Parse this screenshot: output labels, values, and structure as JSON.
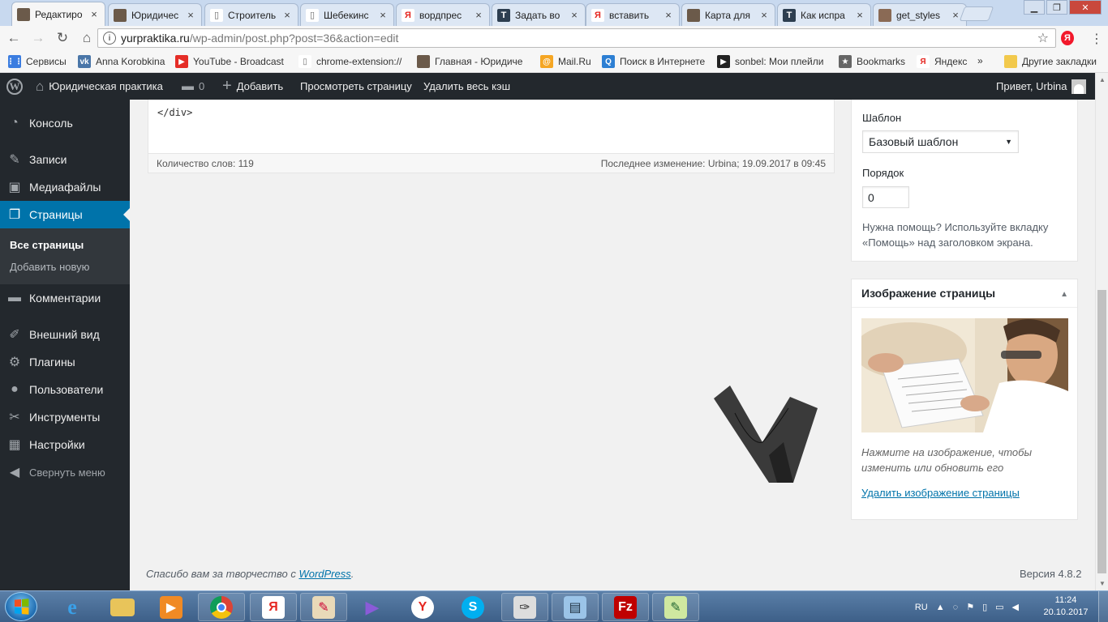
{
  "browser": {
    "tabs": [
      {
        "title": "Редактиро",
        "icon": "site-icon"
      },
      {
        "title": "Юридичес",
        "icon": "site-icon"
      },
      {
        "title": "Строитель",
        "icon": "page-icon"
      },
      {
        "title": "Шебекинс",
        "icon": "page-icon"
      },
      {
        "title": "вордпрес",
        "icon": "yandex-icon"
      },
      {
        "title": "Задать во",
        "icon": "t-icon"
      },
      {
        "title": "вставить",
        "icon": "yandex-icon"
      },
      {
        "title": "Карта для",
        "icon": "site-icon"
      },
      {
        "title": "Как испра",
        "icon": "t-icon"
      },
      {
        "title": "get_styles",
        "icon": "avatar-icon"
      }
    ],
    "url_host": "yurpraktika.ru",
    "url_path": "/wp-admin/post.php?post=36&action=edit",
    "bookmarks": [
      {
        "label": "Сервисы",
        "icon": "apps-icon"
      },
      {
        "label": "Anna Korobkina",
        "icon": "vk-icon"
      },
      {
        "label": "YouTube - Broadcast",
        "icon": "youtube-icon"
      },
      {
        "label": "chrome-extension://",
        "icon": "page-icon"
      },
      {
        "label": "Главная - Юридиче",
        "icon": "site-icon"
      },
      {
        "label": "Mail.Ru",
        "icon": "mail-icon"
      },
      {
        "label": "Поиск в Интернете",
        "icon": "search-icon"
      },
      {
        "label": "sonbel: Мои плейли",
        "icon": "play-icon"
      },
      {
        "label": "Bookmarks",
        "icon": "star-icon"
      },
      {
        "label": "Яндекс",
        "icon": "yandex-icon"
      },
      {
        "label": "»",
        "icon": ""
      },
      {
        "label": "Другие закладки",
        "icon": "folder-icon"
      }
    ],
    "extension_label": "Я"
  },
  "adminbar": {
    "site_name": "Юридическая практика",
    "comments_count": "0",
    "add_new": "Добавить",
    "view_page": "Просмотреть страницу",
    "clear_cache": "Удалить весь кэш",
    "greeting": "Привет, Urbina"
  },
  "sidebar": {
    "items": [
      {
        "label": "Консоль",
        "icon": "dashboard-icon"
      },
      {
        "label": "Записи",
        "icon": "pin-icon"
      },
      {
        "label": "Медиафайлы",
        "icon": "media-icon"
      },
      {
        "label": "Страницы",
        "icon": "pages-icon"
      },
      {
        "label": "Комментарии",
        "icon": "comment-icon"
      },
      {
        "label": "Внешний вид",
        "icon": "brush-icon"
      },
      {
        "label": "Плагины",
        "icon": "plugin-icon"
      },
      {
        "label": "Пользователи",
        "icon": "users-icon"
      },
      {
        "label": "Инструменты",
        "icon": "wrench-icon"
      },
      {
        "label": "Настройки",
        "icon": "settings-icon"
      }
    ],
    "submenu": {
      "all_pages": "Все страницы",
      "add_new": "Добавить новую"
    },
    "collapse": "Свернуть меню"
  },
  "editor": {
    "code_line": "</div>",
    "word_count": "Количество слов: 119",
    "last_modified": "Последнее изменение: Urbina; 19.09.2017 в 09:45"
  },
  "page_attributes": {
    "template_label": "Шаблон",
    "template_value": "Базовый шаблон",
    "order_label": "Порядок",
    "order_value": "0",
    "help_text": "Нужна помощь? Используйте вкладку «Помощь» над заголовком экрана."
  },
  "featured_image": {
    "title": "Изображение страницы",
    "hint": "Нажмите на изображение, чтобы изменить или обновить его",
    "remove_link": "Удалить изображение страницы"
  },
  "footer": {
    "thanks_prefix": "Спасибо вам за творчество с ",
    "thanks_link": "WordPress",
    "thanks_suffix": ".",
    "version": "Версия 4.8.2"
  },
  "taskbar": {
    "language": "RU",
    "time": "11:24",
    "date": "20.10.2017"
  },
  "colors": {
    "wp_dark": "#23282d",
    "wp_blue": "#0073aa",
    "taskbar": "#3d5f88"
  }
}
